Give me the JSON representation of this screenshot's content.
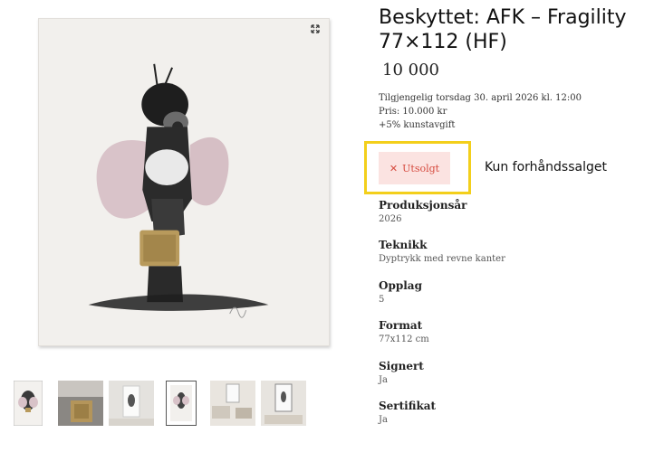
{
  "product": {
    "title_line1": "Beskyttet: AFK – Fragility",
    "title_line2": "77×112 (HF)",
    "price": "10 000",
    "availability": {
      "line1": "Tilgjengelig torsdag 30. april 2026 kl. 12:00",
      "line2": "Pris: 10.000 kr",
      "line3": "+5% kunstavgift"
    },
    "status_button": {
      "icon": "close-icon",
      "label": "Utsolgt"
    },
    "annotation": "Kun forhåndssalget",
    "specs": [
      {
        "label": "Produksjonsår",
        "value": "2026"
      },
      {
        "label": "Teknikk",
        "value": "Dyptrykk med revne kanter"
      },
      {
        "label": "Opplag",
        "value": "5"
      },
      {
        "label": "Format",
        "value": "77x112 cm"
      },
      {
        "label": "Signert",
        "value": "Ja"
      },
      {
        "label": "Sertifikat",
        "value": "Ja"
      }
    ]
  },
  "gallery": {
    "expand_icon": "expand-icon",
    "thumbnail_count": 6
  },
  "colors": {
    "highlight": "#f3cf1b",
    "soldout_bg": "#fbe3e1",
    "soldout_text": "#d64b3f"
  }
}
